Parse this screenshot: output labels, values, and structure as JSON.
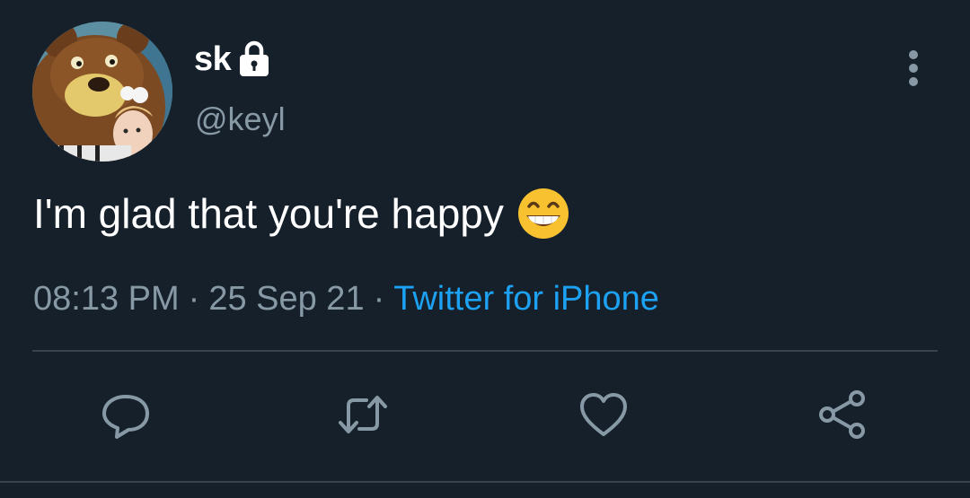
{
  "user": {
    "display_name": "sk",
    "handle": "@keyl",
    "protected_icon": "lock-icon",
    "avatar": "avatar"
  },
  "tweet": {
    "text": "I'm glad that you're happy",
    "emoji": "grinning-face-with-smiling-eyes",
    "time": "08:13 PM",
    "separator": "·",
    "date": "25 Sep 21",
    "source": "Twitter for iPhone"
  },
  "icons": {
    "menu": "more-vertical-icon",
    "reply": "reply-icon",
    "retweet": "retweet-icon",
    "like": "heart-icon",
    "share": "share-icon"
  },
  "colors": {
    "background": "#15202b",
    "text_primary": "#ffffff",
    "text_secondary": "#8899a6",
    "link": "#1da1f2",
    "divider": "#38444d"
  }
}
